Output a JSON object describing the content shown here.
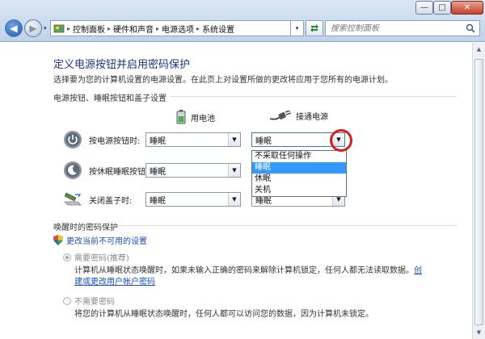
{
  "window": {
    "minimize_glyph": "—",
    "maximize_glyph": "□",
    "close_glyph": "✕"
  },
  "nav": {
    "back_glyph": "◀",
    "forward_glyph": "▶",
    "history_glyph": "▾"
  },
  "address": {
    "crumbs": [
      "控制面板",
      "硬件和声音",
      "电源选项",
      "系统设置"
    ],
    "separator": "▸",
    "dropdown_glyph": "▾"
  },
  "search": {
    "placeholder": "搜索控制面板"
  },
  "page": {
    "title": "定义电源按钮并启用密码保护",
    "description": "选择要为您的计算机设置的电源设置。在此页上对设置所做的更改将应用于您所有的电源计划。",
    "section_power": "电源按钮、睡眠按钮和盖子设置",
    "col_battery": "用电池",
    "col_plugged": "接通电源",
    "rows": [
      {
        "label": "按电源按钮时:",
        "battery": "睡眠",
        "plugged": "睡眠"
      },
      {
        "label": "按休眠睡眠按钮时:",
        "battery": "睡眠",
        "plugged": ""
      },
      {
        "label": "关闭盖子时:",
        "battery": "睡眠",
        "plugged": "睡眠"
      }
    ],
    "dropdown_options": [
      "不采取任何操作",
      "睡眠",
      "休眠",
      "关机"
    ],
    "section_password": "唤醒时的密码保护",
    "change_link": "更改当前不可用的设置",
    "require_password": {
      "label": "需要密码(推荐)",
      "desc_line1": "计算机从睡眠状态唤醒时，如果未输入正确的密码来解除计算机锁定，任何人都无法读取数据。",
      "desc_link_end": "创",
      "desc_line2_link": "建或更改用户帐户密码"
    },
    "no_password": {
      "label": "不需要密码",
      "desc": "将您的计算机从睡眠状态唤醒时，任何人都可以访问您的数据，因为计算机未锁定。"
    }
  },
  "colors": {
    "title": "#1e3287",
    "link": "#1a4fb8",
    "highlight": "#3399ff",
    "annotation": "#d81d1d"
  }
}
